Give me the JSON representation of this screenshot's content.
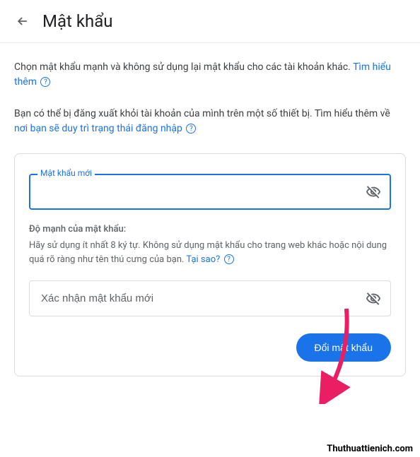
{
  "header": {
    "title": "Mật khẩu"
  },
  "description": {
    "text1_before": "Chọn mật khẩu mạnh và không sử dụng lại mật khẩu cho các tài khoản khác. ",
    "link1": "Tìm hiểu thêm",
    "text2_before": "Bạn có thể bị đăng xuất khỏi tài khoản của mình trên một số thiết bị. Tìm hiểu thêm về ",
    "link2": "nơi bạn sẽ duy trì trạng thái đăng nhập"
  },
  "form": {
    "new_password_label": "Mật khẩu mới",
    "strength_title": "Độ mạnh của mật khẩu:",
    "strength_desc_before": "Hãy sử dụng ít nhất 8 ký tự. Không sử dụng mật khẩu cho trang web khác hoặc nội dung quá rõ ràng như tên thú cưng của bạn. ",
    "strength_link": "Tại sao?",
    "confirm_placeholder": "Xác nhận mật khẩu mới",
    "submit_label": "Đổi mật khẩu"
  },
  "watermark": "Thuthuattienich.com"
}
